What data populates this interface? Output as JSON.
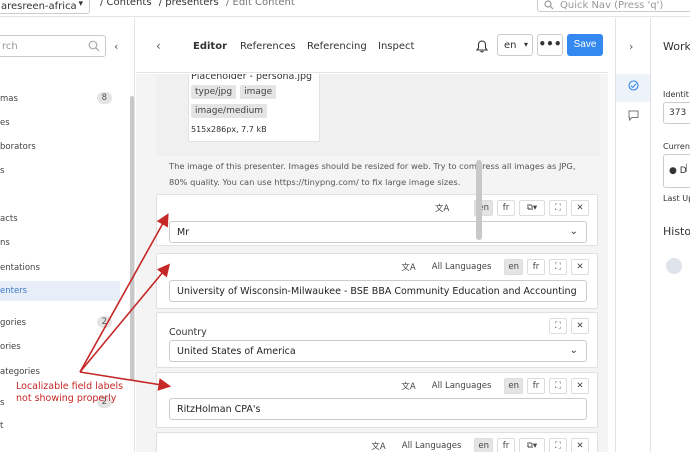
{
  "topbar": {
    "app_name": "aresreen-africa",
    "breadcrumb": [
      "/ Contents",
      "/ presenters",
      "/ Edit Content"
    ],
    "quicknav_placeholder": "Quick Nav (Press 'q')"
  },
  "sidebar": {
    "search_placeholder": "rch",
    "items": [
      {
        "label": "mas",
        "badge": "8"
      },
      {
        "label": "es",
        "badge": ""
      },
      {
        "label": "borators",
        "badge": ""
      },
      {
        "label": "s",
        "badge": ""
      },
      {
        "label": "",
        "badge": ""
      },
      {
        "label": "acts",
        "badge": ""
      },
      {
        "label": "ns",
        "badge": ""
      },
      {
        "label": "entations",
        "badge": ""
      },
      {
        "label": "enters",
        "badge": "",
        "active": true
      },
      {
        "label": "gories",
        "badge": "2"
      },
      {
        "label": "ories",
        "badge": ""
      },
      {
        "label": "ategories",
        "badge": ""
      },
      {
        "label": "s",
        "badge": "2"
      },
      {
        "label": "t",
        "badge": ""
      }
    ]
  },
  "editor": {
    "tabs": [
      "Editor",
      "References",
      "Referencing",
      "Inspect"
    ],
    "active_tab": "Editor",
    "language": "en",
    "save_label": "Save",
    "more_label": "•••"
  },
  "image_asset": {
    "name": "Placeholder - persona.jpg",
    "tags": [
      "type/jpg",
      "image",
      "image/medium"
    ],
    "dims": "515x286px, 7.7 kB",
    "hint": "The image of this presenter. Images should be resized for web. Try to compress all images as JPG, 80% quality. You can use https://tinypng.com/ to fix large image sizes."
  },
  "fields": [
    {
      "id": "title",
      "label": "",
      "value": "Mr",
      "dropdown": true,
      "all_languages": false
    },
    {
      "id": "education",
      "label": "",
      "value": "University of Wisconsin-Milwaukee - BSE BBA Community Education and Accounting",
      "dropdown": false,
      "all_languages": true
    },
    {
      "id": "country",
      "label": "Country",
      "value": "United States of America",
      "dropdown": true,
      "all_languages": false
    },
    {
      "id": "company",
      "label": "",
      "value": "RitzHolman CPA's",
      "dropdown": false,
      "all_languages": true
    },
    {
      "id": "next",
      "label": "",
      "value": "",
      "dropdown": false,
      "all_languages": true
    }
  ],
  "field_tools": {
    "all_languages_label": "All Languages",
    "lang_en": "en",
    "lang_fr": "fr"
  },
  "right_panel": {
    "title": "Work",
    "identity_label": "Identit",
    "identity_value": "373",
    "current_label": "Curren",
    "status_value": "D",
    "last_updated_label": "Last Up",
    "history_title": "Histo"
  },
  "annotation": {
    "text": "Localizable field labels not showing properly",
    "color": "#c62828"
  },
  "colors": {
    "accent": "#3389f0",
    "annotation": "#c62828"
  }
}
